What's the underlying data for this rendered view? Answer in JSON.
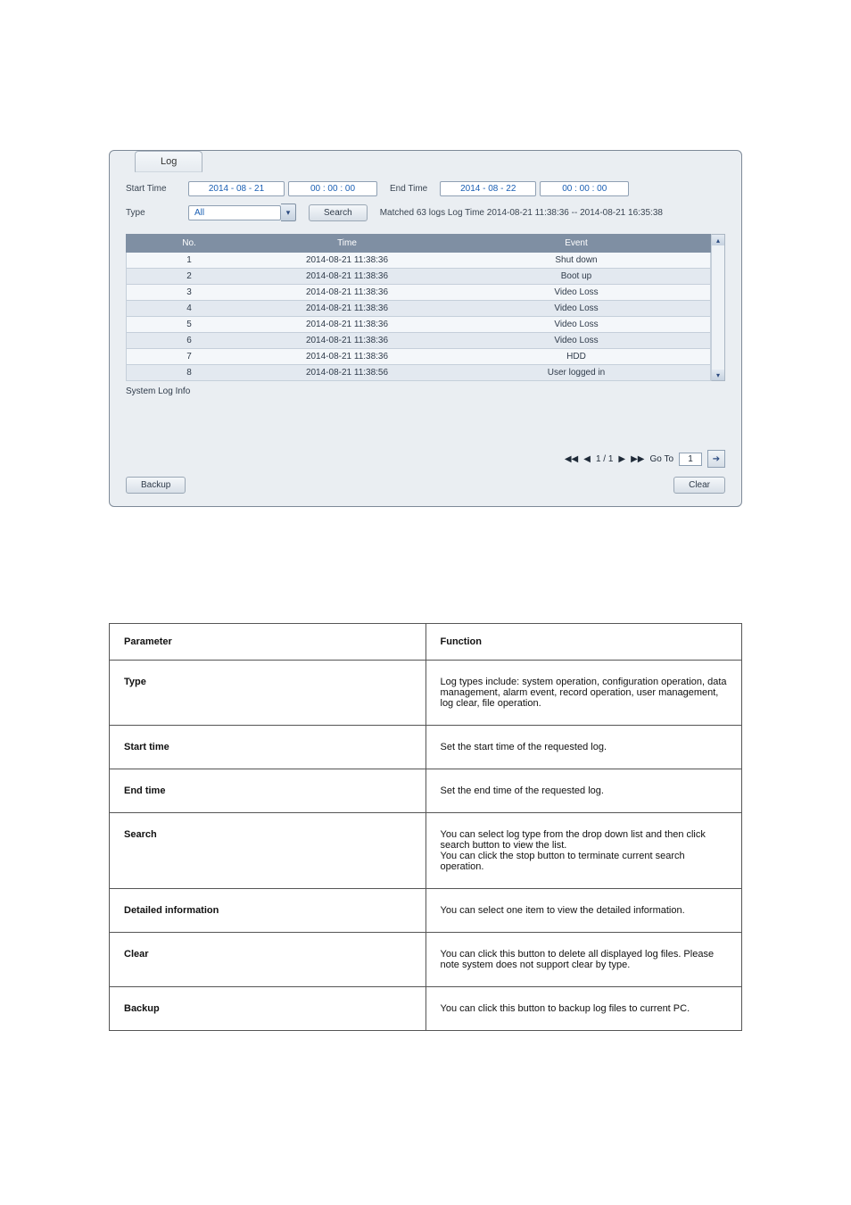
{
  "screenshot": {
    "tab": "Log",
    "labels": {
      "start_time": "Start Time",
      "end_time": "End Time",
      "type": "Type"
    },
    "start_date": "2014  -  08  -  21",
    "start_time": "00  :  00  :  00",
    "end_date": "2014  -  08  -  22",
    "end_time": "00  :  00  :  00",
    "type_value": "All",
    "search_button": "Search",
    "matched_text": "Matched  63 logs   Log Time 2014-08-21 11:38:36 -- 2014-08-21 16:35:38",
    "columns": {
      "no": "No.",
      "time": "Time",
      "event": "Event"
    },
    "rows": [
      {
        "no": "1",
        "time": "2014-08-21 11:38:36",
        "event": "Shut down"
      },
      {
        "no": "2",
        "time": "2014-08-21 11:38:36",
        "event": "Boot up"
      },
      {
        "no": "3",
        "time": "2014-08-21 11:38:36",
        "event": "Video Loss"
      },
      {
        "no": "4",
        "time": "2014-08-21 11:38:36",
        "event": "Video Loss"
      },
      {
        "no": "5",
        "time": "2014-08-21 11:38:36",
        "event": "Video Loss"
      },
      {
        "no": "6",
        "time": "2014-08-21 11:38:36",
        "event": "Video Loss"
      },
      {
        "no": "7",
        "time": "2014-08-21 11:38:36",
        "event": "HDD"
      },
      {
        "no": "8",
        "time": "2014-08-21 11:38:56",
        "event": "User logged in"
      }
    ],
    "system_log_info_label": "System Log Info",
    "pager": {
      "page_text": "1 / 1",
      "goto_label": "Go To",
      "goto_value": "1"
    },
    "backup_button": "Backup",
    "clear_button": "Clear"
  },
  "params_table": {
    "header": {
      "param": "Parameter",
      "function": "Function"
    },
    "rows": [
      {
        "param": "Type",
        "function": "Log types include: system operation, configuration operation, data management, alarm event, record operation, user management, log clear, file operation."
      },
      {
        "param": "Start time",
        "function": "Set the start time of the requested log."
      },
      {
        "param": "End time",
        "function": "Set the end time of the requested log."
      },
      {
        "param": "Search",
        "function": "You can select log type from the drop down list and then click search button to view the list.\nYou can click the stop button to terminate current search operation."
      },
      {
        "param": "Detailed information",
        "function": "You can select one item to view the detailed information."
      },
      {
        "param": "Clear",
        "function": "You can click this button to delete all displayed log files. Please note system does not support clear by type."
      },
      {
        "param": "Backup",
        "function": "You can click this button to backup log files to current PC."
      }
    ]
  }
}
